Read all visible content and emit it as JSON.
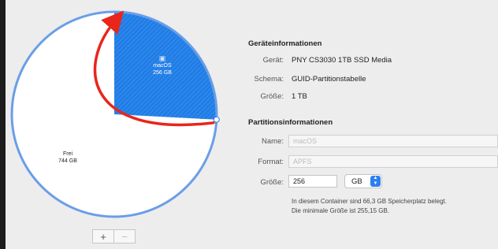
{
  "pie": {
    "segments": [
      {
        "label": "macOS",
        "size": "256 GB",
        "color": "#1f7de6"
      },
      {
        "label": "Frei",
        "size": "744 GB",
        "color": "#ffffff"
      }
    ],
    "rim_color": "#6b9ee6",
    "annotation_color": "#e8261b"
  },
  "controls": {
    "add": "+",
    "remove": "−"
  },
  "device_info": {
    "title": "Geräteinformationen",
    "rows": [
      {
        "label": "Gerät:",
        "value": "PNY CS3030 1TB SSD Media"
      },
      {
        "label": "Schema:",
        "value": "GUID-Partitionstabelle"
      },
      {
        "label": "Größe:",
        "value": "1 TB"
      }
    ]
  },
  "partition_info": {
    "title": "Partitionsinformationen",
    "name_label": "Name:",
    "name_value": "macOS",
    "format_label": "Format:",
    "format_value": "APFS",
    "size_label": "Größe:",
    "size_value": "256",
    "unit": "GB",
    "note_line1": "In diesem Container sind 66,3 GB Speicherplatz belegt.",
    "note_line2": "Die minimale Größe ist 255,15 GB."
  }
}
